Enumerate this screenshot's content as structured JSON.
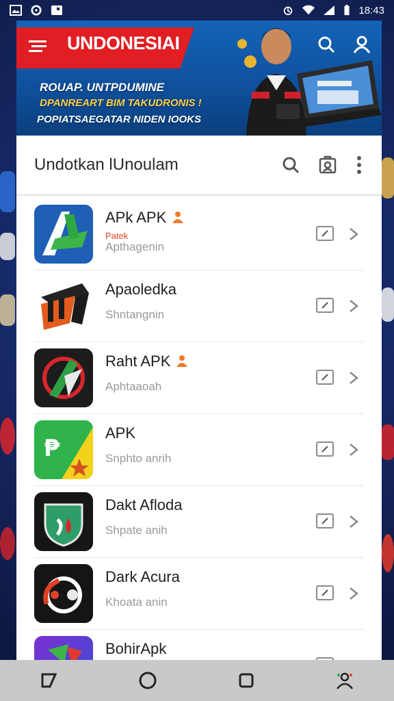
{
  "status_bar": {
    "time": "18:43",
    "left_icons": [
      "gallery-icon",
      "circle-icon",
      "notification-icon"
    ],
    "right_icons": [
      "alarm-icon",
      "wifi-icon",
      "signal-icon",
      "battery-icon"
    ]
  },
  "banner": {
    "title": "UNDONESIAI",
    "line1": "ROUAP. UNTPDUMINE",
    "line2": "DPANREART BIM TAKUDRONIS !",
    "line3": "POPIATSAEGATAR NIDEN IOOKS",
    "accent_color": "#e01e24"
  },
  "card": {
    "title": "Undotkan lUnoulam",
    "header_icons": [
      "search-icon",
      "bookmark-icon",
      "more-vert-icon"
    ]
  },
  "apps": [
    {
      "name": "APk APK",
      "tag": "Patek",
      "subtitle": "Apthagenin",
      "badge": true
    },
    {
      "name": "Apaoledka",
      "tag": "",
      "subtitle": "Shntangnin",
      "badge": false
    },
    {
      "name": "Raht APK",
      "tag": "",
      "subtitle": "Aphtaaoah",
      "badge": true
    },
    {
      "name": "APK",
      "tag": "",
      "subtitle": "Snphto anrih",
      "badge": false
    },
    {
      "name": "Dakt Afloda",
      "tag": "",
      "subtitle": "Shpate anih",
      "badge": false
    },
    {
      "name": "Dark Acura",
      "tag": "",
      "subtitle": "Khoata anin",
      "badge": false
    },
    {
      "name": "BohirApk",
      "tag": "",
      "subtitle": "",
      "badge": false
    }
  ],
  "navbar": {
    "icons": [
      "back-icon",
      "home-icon",
      "recents-icon",
      "assistant-icon"
    ]
  }
}
